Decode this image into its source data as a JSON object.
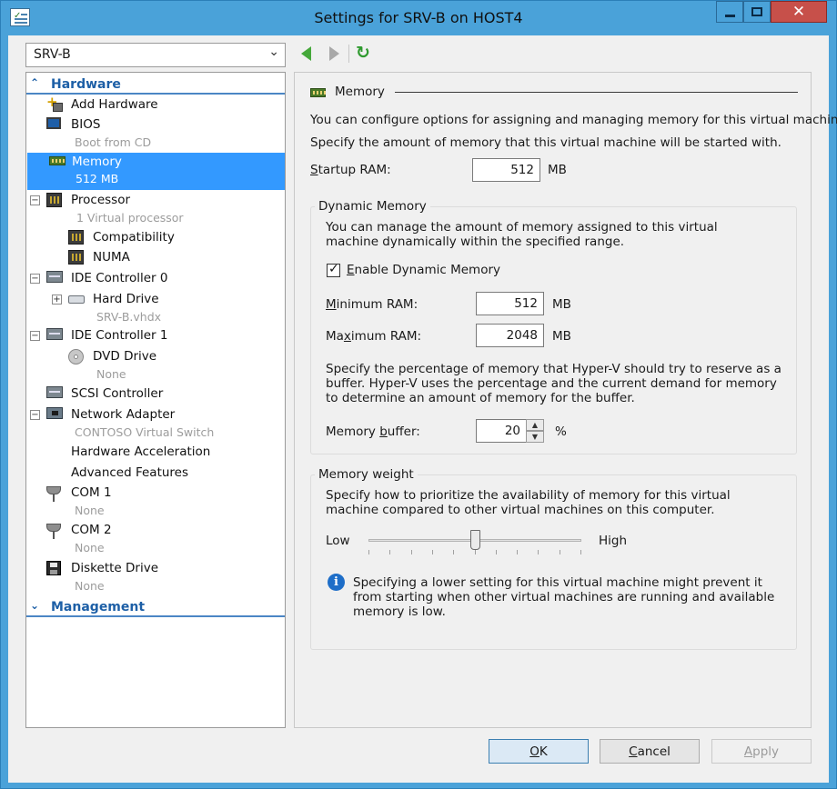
{
  "window": {
    "title": "Settings for SRV-B on HOST4",
    "minimize_label": "",
    "maximize_label": "",
    "close_glyph": "✕"
  },
  "toolbar": {
    "vm_selector_value": "SRV-B"
  },
  "tree": {
    "hardware_header": "Hardware",
    "management_header": "Management",
    "items": [
      {
        "label": "Add Hardware",
        "sub": ""
      },
      {
        "label": "BIOS",
        "sub": "Boot from CD"
      },
      {
        "label": "Memory",
        "sub": "512 MB",
        "selected": true
      },
      {
        "label": "Processor",
        "sub": "1 Virtual processor"
      },
      {
        "label": "Compatibility",
        "sub": ""
      },
      {
        "label": "NUMA",
        "sub": ""
      },
      {
        "label": "IDE Controller 0",
        "sub": ""
      },
      {
        "label": "Hard Drive",
        "sub": "SRV-B.vhdx"
      },
      {
        "label": "IDE Controller 1",
        "sub": ""
      },
      {
        "label": "DVD Drive",
        "sub": "None"
      },
      {
        "label": "SCSI Controller",
        "sub": ""
      },
      {
        "label": "Network Adapter",
        "sub": "CONTOSO Virtual Switch"
      },
      {
        "label": "Hardware Acceleration",
        "sub": ""
      },
      {
        "label": "Advanced Features",
        "sub": ""
      },
      {
        "label": "COM 1",
        "sub": "None"
      },
      {
        "label": "COM 2",
        "sub": "None"
      },
      {
        "label": "Diskette Drive",
        "sub": "None"
      }
    ]
  },
  "memory": {
    "section_title": "Memory",
    "intro1": "You can configure options for assigning and managing memory for this virtual machine.",
    "intro2": "Specify the amount of memory that this virtual machine will be started with.",
    "startup_label_u": "S",
    "startup_label_rest": "tartup RAM:",
    "startup_value": "512",
    "unit_mb": "MB",
    "dynamic": {
      "group_title": "Dynamic Memory",
      "desc": "You can manage the amount of memory assigned to this virtual machine dynamically within the specified range.",
      "enable_u": "E",
      "enable_rest": "nable Dynamic Memory",
      "enabled": true,
      "min_u": "M",
      "min_rest": "inimum RAM:",
      "min_value": "512",
      "max_pre": "Ma",
      "max_u": "x",
      "max_rest": "imum RAM:",
      "max_value": "2048",
      "buffer_desc": "Specify the percentage of memory that Hyper-V should try to reserve as a buffer. Hyper-V uses the percentage and the current demand for memory to determine an amount of memory for the buffer.",
      "buffer_pre": "Memory ",
      "buffer_u": "b",
      "buffer_rest": "uffer:",
      "buffer_value": "20",
      "buffer_unit": "%"
    },
    "weight": {
      "group_title": "Memory weight",
      "desc": "Specify how to prioritize the availability of memory for this virtual machine compared to other virtual machines on this computer.",
      "low_label": "Low",
      "high_label": "High",
      "level": 0.5,
      "info": "Specifying a lower setting for this virtual machine might prevent it from starting when other virtual machines are running and available memory is low."
    }
  },
  "buttons": {
    "ok_u": "O",
    "ok_rest": "K",
    "cancel_u": "C",
    "cancel_rest": "ancel",
    "apply_u": "A",
    "apply_rest": "pply"
  },
  "colors": {
    "window_frame": "#4aa2d9",
    "selection": "#3399ff",
    "section_header": "#1d5fa6",
    "close_button": "#c7504a"
  }
}
